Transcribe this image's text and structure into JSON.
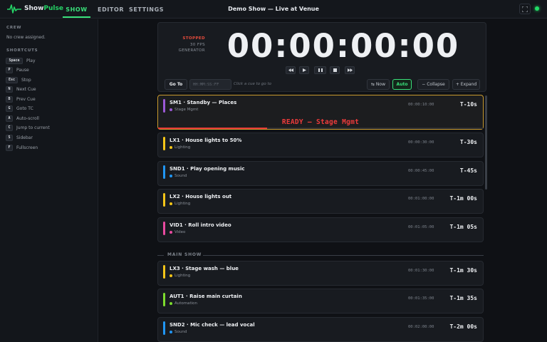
{
  "app": {
    "name_a": "Show",
    "name_b": "Pulse",
    "title": "Demo Show — Live at Venue"
  },
  "nav": {
    "tabs": [
      {
        "label": "SHOW"
      },
      {
        "label": "EDITOR"
      },
      {
        "label": "SETTINGS"
      }
    ]
  },
  "sidebar": {
    "crew_heading": "CREW",
    "crew_empty": "No crew assigned.",
    "shortcuts_heading": "SHORTCUTS",
    "shortcuts": [
      {
        "key": "Space",
        "label": "Play"
      },
      {
        "key": "P",
        "label": "Pause"
      },
      {
        "key": "Esc",
        "label": "Stop"
      },
      {
        "key": "N",
        "label": "Next Cue"
      },
      {
        "key": "B",
        "label": "Prev Cue"
      },
      {
        "key": "G",
        "label": "Goto TC"
      },
      {
        "key": "A",
        "label": "Auto-scroll"
      },
      {
        "key": "C",
        "label": "Jump to current"
      },
      {
        "key": "S",
        "label": "Sidebar"
      },
      {
        "key": "F",
        "label": "Fullscreen"
      }
    ]
  },
  "clock": {
    "state": "STOPPED",
    "fps": "30 FPS",
    "source": "GENERATOR",
    "timecode": "00:00:00:00",
    "goto_label": "Go To",
    "tc_placeholder": "HH:MM:SS:FF",
    "hint": "Click a cue to go to",
    "now_label": "⇆ Now",
    "auto_label": "Auto",
    "collapse_label": "− Collapse",
    "expand_label": "+ Expand"
  },
  "colors": {
    "accent": "#39e07a",
    "stopped": "#e74c3c",
    "active_border": "#c99a2e"
  },
  "cues": [
    {
      "title": "SM1 · Standby — Places",
      "dept": "Stage Mgmt",
      "color": "#9b59d6",
      "tc": "00:00:10:00",
      "countdown": "T-10s",
      "active": true,
      "ready": "READY — Stage Mgmt",
      "progress": 0.335
    },
    {
      "title": "LX1 · House lights to 50%",
      "dept": "Lighting",
      "color": "#f5c518",
      "tc": "00:00:30:00",
      "countdown": "T-30s"
    },
    {
      "title": "SND1 · Play opening music",
      "dept": "Sound",
      "color": "#2196f3",
      "tc": "00:00:45:00",
      "countdown": "T-45s"
    },
    {
      "title": "LX2 · House lights out",
      "dept": "Lighting",
      "color": "#f5c518",
      "tc": "00:01:00:00",
      "countdown": "T-1m 00s"
    },
    {
      "title": "VID1 · Roll intro video",
      "dept": "Video",
      "color": "#e94aa0",
      "tc": "00:01:05:00",
      "countdown": "T-1m 05s"
    },
    {
      "title": "LX3 · Stage wash — blue",
      "dept": "Lighting",
      "color": "#f5c518",
      "tc": "00:01:30:00",
      "countdown": "T-1m 30s"
    },
    {
      "title": "AUT1 · Raise main curtain",
      "dept": "Automation",
      "color": "#7ddc2e",
      "tc": "00:01:35:00",
      "countdown": "T-1m 35s"
    },
    {
      "title": "SND2 · Mic check — lead vocal",
      "dept": "Sound",
      "color": "#2196f3",
      "tc": "00:02:00:00",
      "countdown": "T-2m 00s"
    }
  ],
  "section": {
    "label": "MAIN SHOW"
  }
}
